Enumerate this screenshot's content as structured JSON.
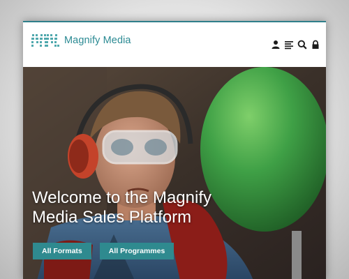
{
  "brand": {
    "name": "Magnify Media",
    "logo_icon": "mm-logo-icon",
    "color": "#2b8a93"
  },
  "header": {
    "icons": [
      "user-icon",
      "menu-icon",
      "search-icon",
      "lock-icon"
    ]
  },
  "hero": {
    "title": "Welcome to the Magnify Media Sales Platform",
    "buttons": {
      "formats": "All Formats",
      "programmes": "All Programmes"
    },
    "button_color": "#2f8a8f"
  }
}
